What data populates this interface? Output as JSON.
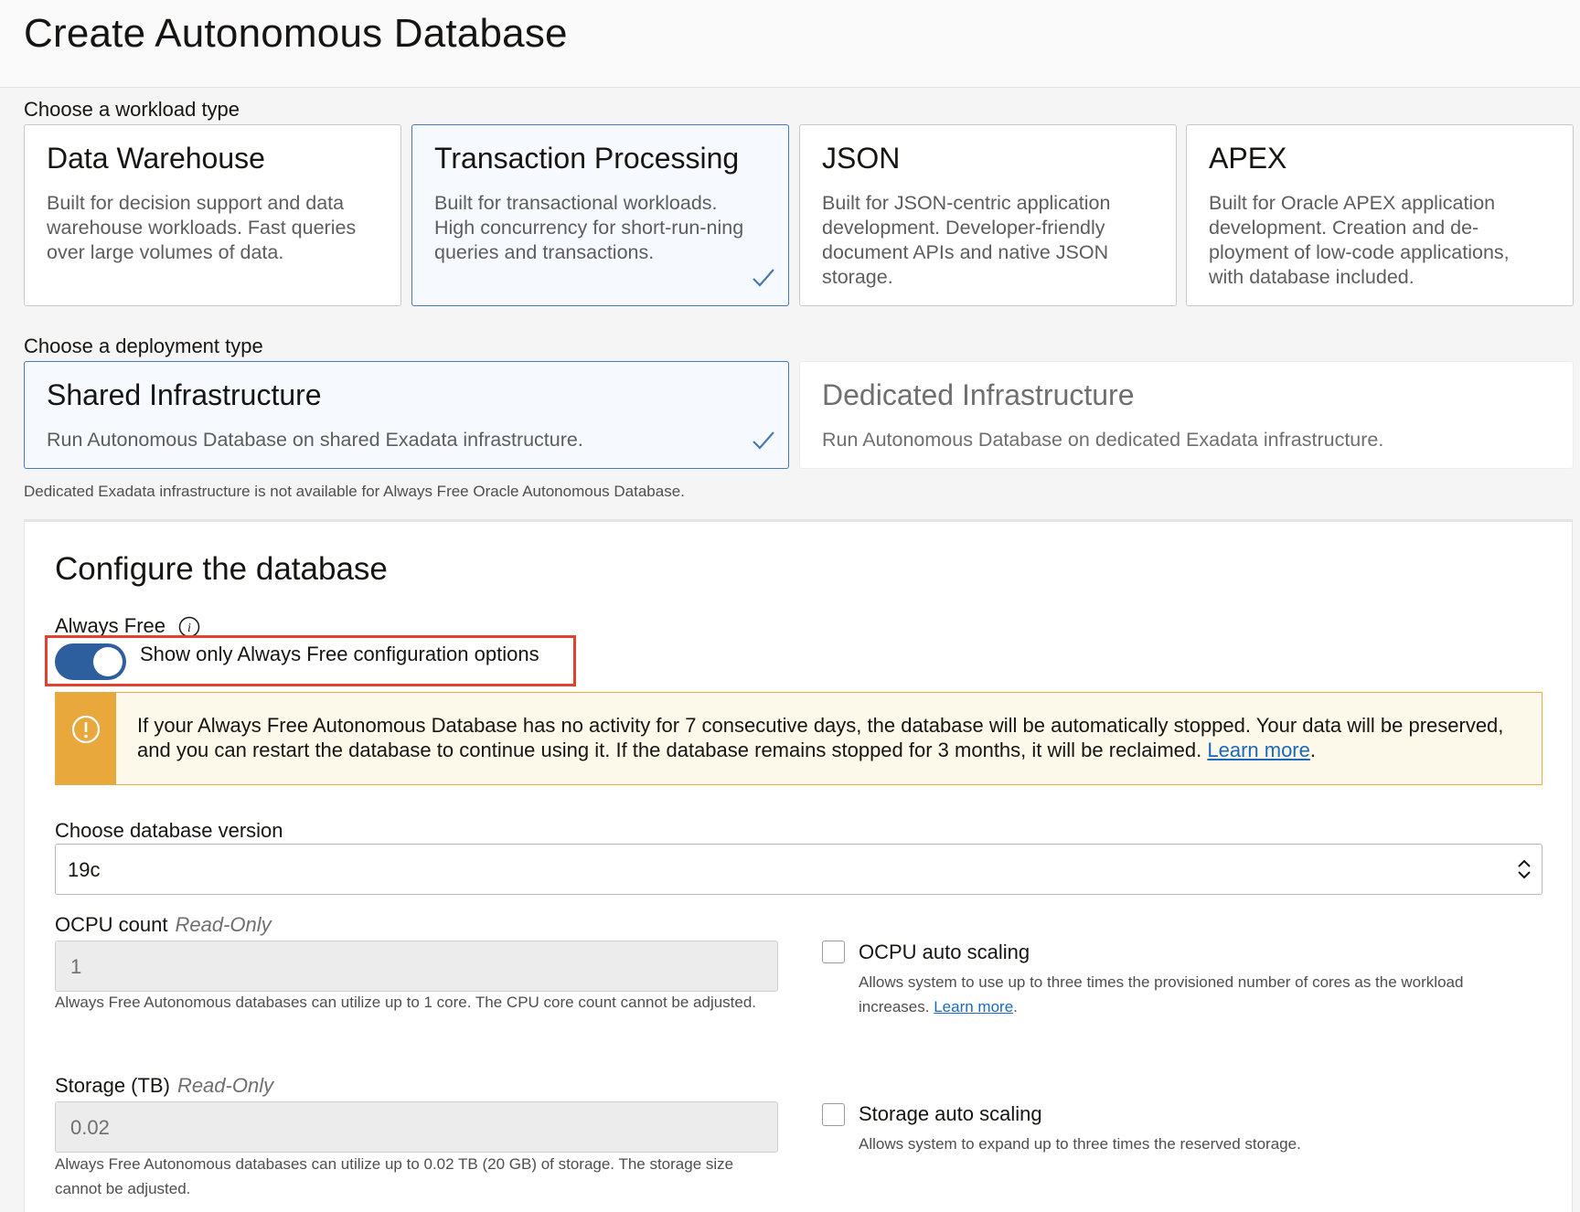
{
  "header": {
    "title": "Create Autonomous Database"
  },
  "workload": {
    "label": "Choose a workload type",
    "options": [
      {
        "title": "Data Warehouse",
        "description": "Built for decision support and data warehouse workloads. Fast queries over large volumes of data.",
        "selected": false
      },
      {
        "title": "Transaction Processing",
        "description": "Built for transactional workloads. High concurrency for short-run-ning queries and transactions.",
        "selected": true
      },
      {
        "title": "JSON",
        "description": "Built for JSON-centric application development. Developer-friendly document APIs and native JSON storage.",
        "selected": false
      },
      {
        "title": "APEX",
        "description": "Built for Oracle APEX application development. Creation and de-ployment of low-code applications, with database included.",
        "selected": false
      }
    ]
  },
  "deployment": {
    "label": "Choose a deployment type",
    "options": [
      {
        "title": "Shared Infrastructure",
        "description": "Run Autonomous Database on shared Exadata infrastructure.",
        "selected": true
      },
      {
        "title": "Dedicated Infrastructure",
        "description": "Run Autonomous Database on dedicated Exadata infrastructure.",
        "selected": false,
        "disabled": true
      }
    ],
    "note": "Dedicated Exadata infrastructure is not available for Always Free Oracle Autonomous Database."
  },
  "configure": {
    "title": "Configure the database",
    "always_free": {
      "label": "Always Free",
      "toggle_label": "Show only Always Free configuration options",
      "toggle_on": true
    },
    "warning": {
      "text": "If your Always Free Autonomous Database has no activity for 7 consecutive days, the database will be automatically stopped. Your data will be preserved, and you can restart the database to continue using it. If the database remains stopped for 3 months, it will be reclaimed.",
      "link": "Learn more",
      "after_link": "."
    },
    "version": {
      "label": "Choose database version",
      "value": "19c"
    },
    "ocpu": {
      "label": "OCPU count",
      "readonly": "Read-Only",
      "value": "1",
      "help": "Always Free Autonomous databases can utilize up to 1 core. The CPU core count cannot be adjusted.",
      "autoscale_label": "OCPU auto scaling",
      "autoscale_help": "Allows system to use up to three times the provisioned number of cores as the workload increases.",
      "autoscale_link": "Learn more",
      "autoscale_after_link": "."
    },
    "storage": {
      "label": "Storage (TB)",
      "readonly": "Read-Only",
      "value": "0.02",
      "help": "Always Free Autonomous databases can utilize up to 0.02 TB (20 GB) of storage. The storage size cannot be adjusted.",
      "autoscale_label": "Storage auto scaling",
      "autoscale_help": "Allows system to expand up to three times the reserved storage."
    }
  },
  "colors": {
    "accent": "#2d5e9e",
    "selected_border": "#4779b5",
    "warning": "#e9a83b",
    "highlight": "#e0422f",
    "link": "#1b69b8"
  }
}
